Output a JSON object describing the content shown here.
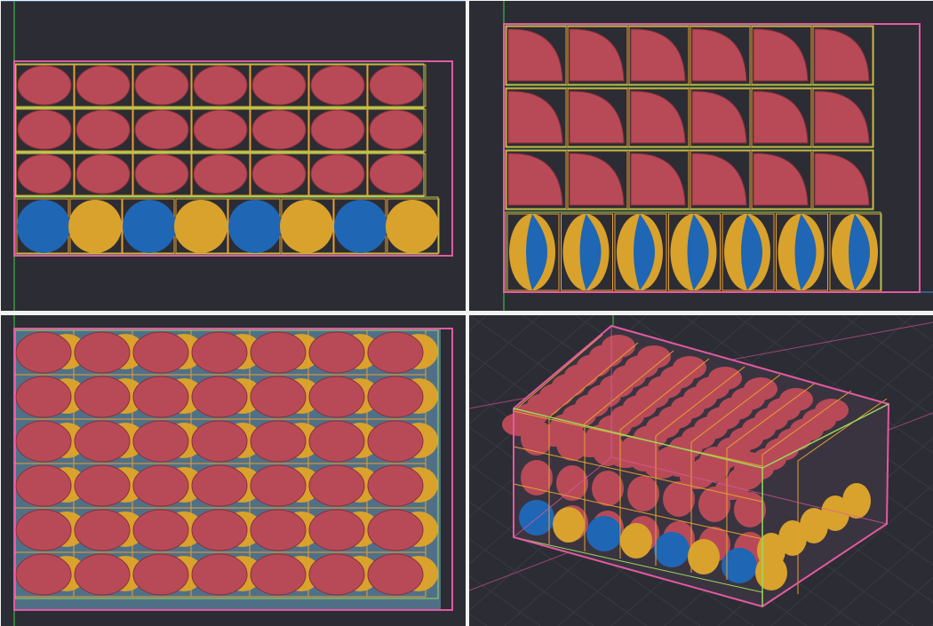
{
  "viewports": [
    {
      "id": "front",
      "projection": "orthographic-front",
      "interactive": true
    },
    {
      "id": "side",
      "projection": "orthographic-side",
      "interactive": true
    },
    {
      "id": "top",
      "projection": "orthographic-top",
      "interactive": true
    },
    {
      "id": "perspective",
      "projection": "perspective",
      "interactive": true
    }
  ],
  "scene": {
    "container": {
      "outline": "pink"
    },
    "layer_boxes": {
      "outline": "green"
    },
    "item_boxes": {
      "outline": "orange"
    },
    "layers": [
      {
        "kind": "red-disc",
        "rows": 3,
        "per_row": 7
      },
      {
        "kind": "blue-yellow-hemisphere-pairs",
        "rows": 1,
        "pairs": 4
      }
    ],
    "top_grid": {
      "rows": 6,
      "cols": 7
    }
  },
  "colors": {
    "background": "#2c2c34",
    "grid": "#3a3a44",
    "container_outline": "#e25aa0",
    "layer_outline": "#98d85c",
    "item_outline": "#e8a030",
    "axis_green": "#44d04a",
    "axis_blue": "#3e8ee0",
    "red_part": "#b84a58",
    "red_part_dark": "#8a2f3c",
    "blue_part": "#1f66b5",
    "yellow_part": "#d8a22c",
    "light_blue": "#7cc4ee"
  }
}
